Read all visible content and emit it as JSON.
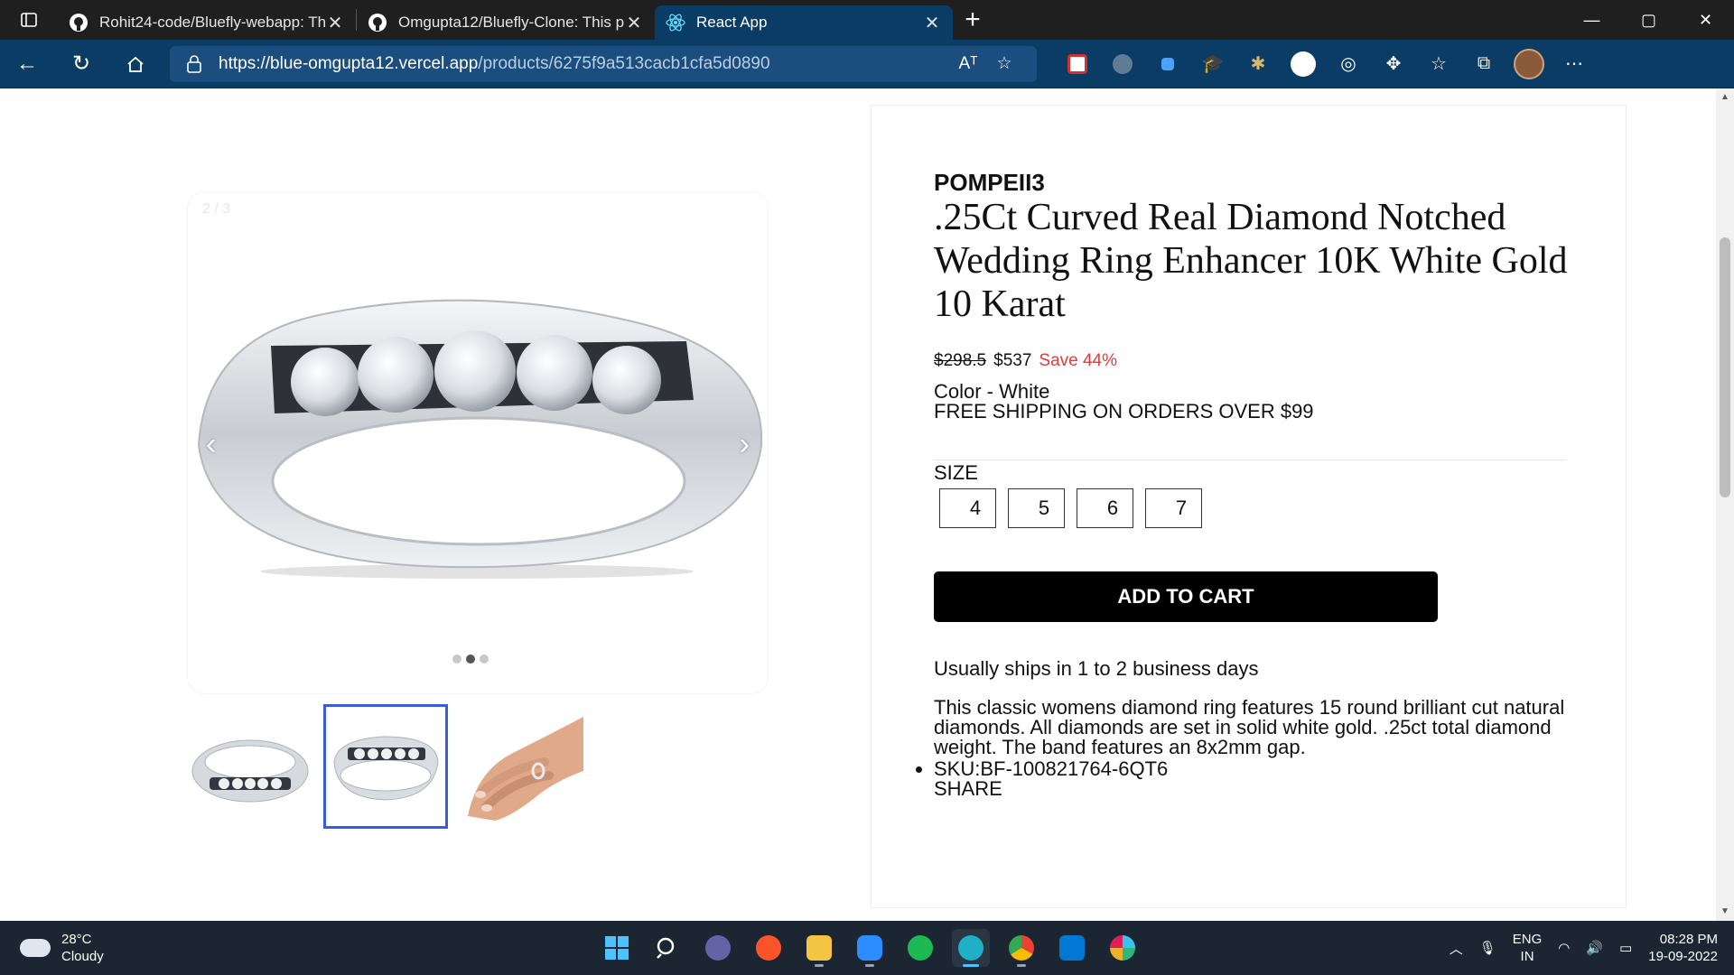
{
  "browser": {
    "tabs": [
      {
        "title": "Rohit24-code/Bluefly-webapp: Th",
        "icon": "github-icon",
        "active": false
      },
      {
        "title": "Omgupta12/Bluefly-Clone: This p",
        "icon": "github-icon",
        "active": false
      },
      {
        "title": "React App",
        "icon": "react-icon",
        "active": true
      }
    ],
    "new_tab": "+",
    "url_host": "https://blue-omgupta12.vercel.app",
    "url_path": "/products/6275f9a513cacb1cfa5d0890",
    "read_aloud": "Aᵀ",
    "window_controls": [
      "—",
      "▢",
      "✕"
    ]
  },
  "gallery": {
    "counter": "2 / 3",
    "prev": "‹",
    "next": "›",
    "active_index": 1,
    "slide_count": 3
  },
  "product": {
    "brand": "POMPEII3",
    "title": ".25Ct Curved Real Diamond Notched Wedding Ring Enhancer 10K White Gold 10 Karat",
    "price_old": "$298.5",
    "price_new": "$537",
    "save": "Save 44%",
    "color": "Color - White",
    "shipping_banner": "FREE SHIPPING ON ORDERS OVER $99",
    "size_label": "SIZE",
    "sizes": [
      "4",
      "5",
      "6",
      "7"
    ],
    "add_to_cart": "ADD TO CART",
    "ships": "Usually ships in 1 to 2 business days",
    "description": "This classic womens diamond ring features 15 round brilliant cut natural diamonds. All diamonds are set in solid white gold. .25ct total diamond weight. The band features an 8x2mm gap.",
    "sku": "SKU:BF-100821764-6QT6",
    "share": "SHARE"
  },
  "taskbar": {
    "weather_temp": "28°C",
    "weather_desc": "Cloudy",
    "lang_top": "ENG",
    "lang_bottom": "IN",
    "time": "08:28 PM",
    "date": "19-09-2022",
    "pinned": [
      "start-icon",
      "search-icon",
      "teams-icon",
      "brave-icon",
      "file-explorer-icon",
      "zoom-icon",
      "spotify-icon",
      "edge-icon",
      "chrome-icon",
      "vscode-icon",
      "slack-icon"
    ]
  },
  "colors": {
    "accent": "#0b3c66",
    "save_red": "#e53935",
    "thumb_border": "#3b5bdb"
  }
}
